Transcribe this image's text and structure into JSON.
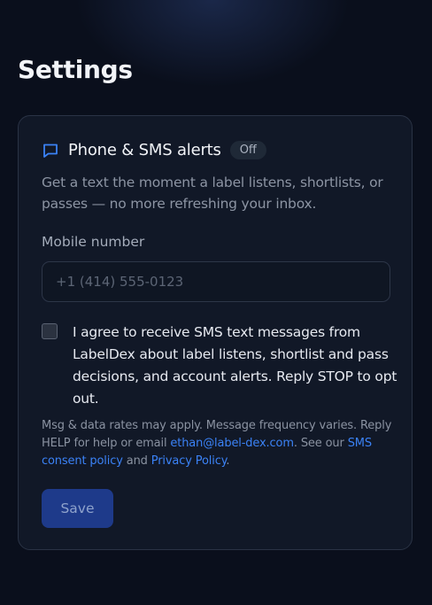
{
  "page": {
    "title": "Settings"
  },
  "card": {
    "title": "Phone & SMS alerts",
    "status_badge": "Off",
    "description": "Get a text the moment a label listens, shortlists, or passes — no more refreshing your inbox.",
    "icon": "chat-bubble-icon"
  },
  "phone": {
    "label": "Mobile number",
    "value": "",
    "placeholder": "+1 (414) 555-0123"
  },
  "consent": {
    "checked": false,
    "text": "I agree to receive SMS text messages from LabelDex about label listens, shortlist and pass decisions, and account alerts. Reply STOP to opt out."
  },
  "fine_print": {
    "text_1": "Msg & data rates may apply. Message frequency varies. Reply HELP for help or email ",
    "email_link": "ethan@label-dex.com",
    "text_2": ". See our ",
    "sms_policy_link": "SMS consent policy",
    "text_3": " and ",
    "privacy_link": "Privacy Policy",
    "text_4": "."
  },
  "actions": {
    "save_label": "Save"
  },
  "colors": {
    "background": "#0a0f1c",
    "card": "#111827",
    "accent": "#3b82f6",
    "save_button": "#1e3a8a"
  }
}
